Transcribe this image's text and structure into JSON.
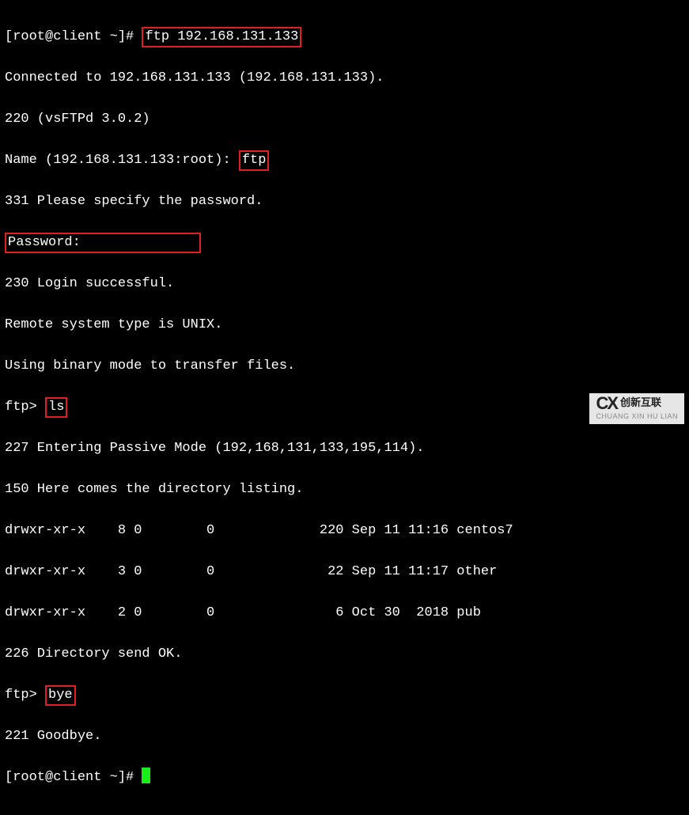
{
  "prompt1_pre": "[root@client ~]# ",
  "cmd1": "ftp 192.168.131.133",
  "l_connected": "Connected to 192.168.131.133 (192.168.131.133).",
  "l_220": "220 (vsFTPd 3.0.2)",
  "name_prompt": "Name (192.168.131.133:root): ",
  "name_input": "ftp",
  "l_331": "331 Please specify the password.",
  "password_label": "Password:",
  "l_230": "230 Login successful.",
  "l_remote": "Remote system type is UNIX.",
  "l_binary": "Using binary mode to transfer files.",
  "ftp_prompt": "ftp> ",
  "cmd_ls": "ls",
  "l_227": "227 Entering Passive Mode (192,168,131,133,195,114).",
  "l_150": "150 Here comes the directory listing.",
  "dir_rows": [
    "drwxr-xr-x    8 0        0             220 Sep 11 11:16 centos7",
    "drwxr-xr-x    3 0        0              22 Sep 11 11:17 other",
    "drwxr-xr-x    2 0        0               6 Oct 30  2018 pub"
  ],
  "l_226": "226 Directory send OK.",
  "cmd_bye": "bye",
  "l_221": "221 Goodbye.",
  "prompt2_pre": "[root@client ~]# ",
  "watermark_top": "创新互联",
  "watermark_sub": "CHUANG XIN HU LIAN"
}
